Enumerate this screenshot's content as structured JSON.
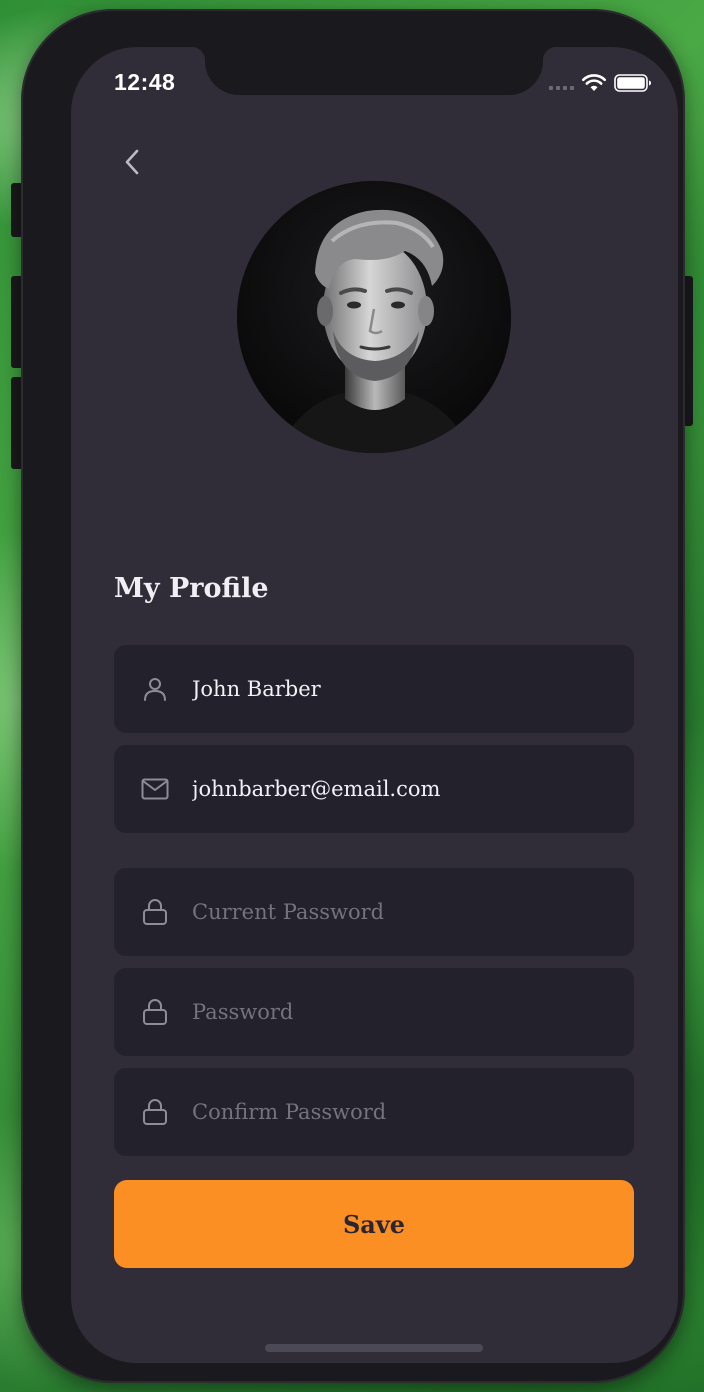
{
  "status_bar": {
    "time": "12:48"
  },
  "icons": {
    "back": "chevron-left-icon",
    "name": "user-icon",
    "email": "mail-icon",
    "password": "lock-icon"
  },
  "profile": {
    "title": "My Profile"
  },
  "form": {
    "name_value": "John Barber",
    "email_value": "johnbarber@email.com",
    "current_password_placeholder": "Current Password",
    "password_placeholder": "Password",
    "confirm_password_placeholder": "Confirm Password",
    "save_label": "Save"
  },
  "colors": {
    "screen_background": "#302d38",
    "field_background": "#23212b",
    "accent": "#fb8f24",
    "placeholder": "#75727f",
    "text": "#f3f1f6"
  }
}
